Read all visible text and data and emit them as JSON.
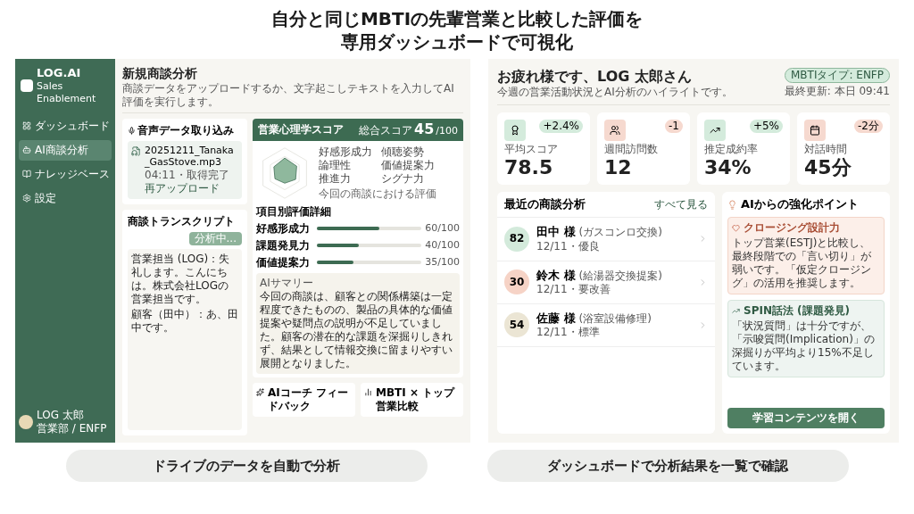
{
  "headline": [
    "自分と同じMBTIの先輩営業と比較した評価を",
    "専用ダッシュボードで可視化"
  ],
  "analysis_screen": {
    "sidebar": {
      "logo": "LOG.AI",
      "tagline": "Sales Enablement",
      "items": [
        {
          "label": "ダッシュボード",
          "selected": false
        },
        {
          "label": "AI商談分析",
          "selected": true
        },
        {
          "label": "ナレッジベース",
          "selected": false
        },
        {
          "label": "設定",
          "selected": false
        }
      ],
      "user": {
        "name": "LOG 太郎",
        "role": "営業部 / ENFP"
      }
    },
    "title": "新規商談分析",
    "subtitle": "商談データをアップロードするか、文字起こしテキストを入力してAI評価を実行します。",
    "upload": {
      "title": "音声データ取り込み",
      "file": "20251211_Tanaka_GasStove.mp3",
      "meta": "04:11・取得完了",
      "action": "再アップロード"
    },
    "transcript": {
      "title": "商談トランスクリプト",
      "button": "分析中...",
      "lines": [
        "営業担当 (LOG)：失礼します。こんにちは。株式会社LOGの営業担当です。",
        "顧客（田中）：あ、田中です。"
      ]
    },
    "score": {
      "title": "営業心理学スコア",
      "total_label": "総合スコア",
      "total": "45",
      "max": "/100",
      "radar_labels": [
        "好感形成力",
        "傾聴姿勢",
        "論理性",
        "価値提案力",
        "推進力",
        "シグナ力"
      ],
      "radar_caption": "今回の商談における評価",
      "details_title": "項目別評価詳細",
      "items": [
        {
          "name": "好感形成力",
          "score": "60/100",
          "level": 0.6
        },
        {
          "name": "課題発見力",
          "score": "40/100",
          "level": 0.4
        },
        {
          "name": "価値提案力",
          "score": "35/100",
          "level": 0.35
        }
      ]
    },
    "summary": {
      "title": "AIサマリー",
      "text": "今回の商談は、顧客との関係構築は一定程度できたものの、製品の具体的な価値提案や疑問点の説明が不足していました。顧客の潜在的な課題を深掘りしきれず、結果として情報交換に留まりやすい展開となりました。"
    },
    "cards": [
      "AIコーチ フィードバック",
      "MBTI × トップ営業比較"
    ]
  },
  "dashboard_screen": {
    "greeting": "お疲れ様です、LOG 太郎さん",
    "subtitle": "今週の営業活動状況とAI分析のハイライトです。",
    "badge": "MBTIタイプ: ENFP",
    "updated": "最終更新: 本日 09:41",
    "stats": [
      {
        "kind": "award",
        "label": "平均スコア",
        "value": "78.5",
        "delta": "+2.4%",
        "color": "#d4ebdc"
      },
      {
        "kind": "users",
        "label": "週間訪問数",
        "value": "12",
        "delta": "-1",
        "color": "#f6d9cf"
      },
      {
        "kind": "trend",
        "label": "推定成約率",
        "value": "34%",
        "delta": "+5%",
        "color": "#d4ebdc"
      },
      {
        "kind": "calendar",
        "label": "対話時間",
        "value": "45分",
        "delta": "-2分",
        "color": "#f6d9cf"
      }
    ],
    "recent": {
      "title": "最近の商談分析",
      "link": "すべて見る",
      "rows": [
        {
          "score": "82",
          "name": "田中 様",
          "note": "(ガスコンロ交換)",
          "meta": "12/11・優良",
          "color": "#d3eadb"
        },
        {
          "score": "30",
          "name": "鈴木 様",
          "note": "(給湯器交換提案)",
          "meta": "12/11・要改善",
          "color": "#f6d3c6"
        },
        {
          "score": "54",
          "name": "佐藤 様",
          "note": "(浴室設備修理)",
          "meta": "12/11・標準",
          "color": "#ebe5d4"
        }
      ]
    },
    "tips": {
      "title": "AIからの強化ポイント",
      "items": [
        {
          "kind": "warning",
          "title": "クロージング設計力",
          "text": "トップ営業(ESTJ)と比較し、最終段階での「言い切り」が弱いです。「仮定クロージング」の活用を推奨します。"
        },
        {
          "kind": "insight",
          "title": "SPIN話法 (課題発見)",
          "text": "「状況質問」は十分ですが、「示唆質問(Implication)」の深掘りが平均より15%不足しています。"
        }
      ],
      "button": "学習コンテンツを開く"
    }
  },
  "captions": [
    "ドライブのデータを自動で分析",
    "ダッシュボードで分析結果を一覧で確認"
  ]
}
